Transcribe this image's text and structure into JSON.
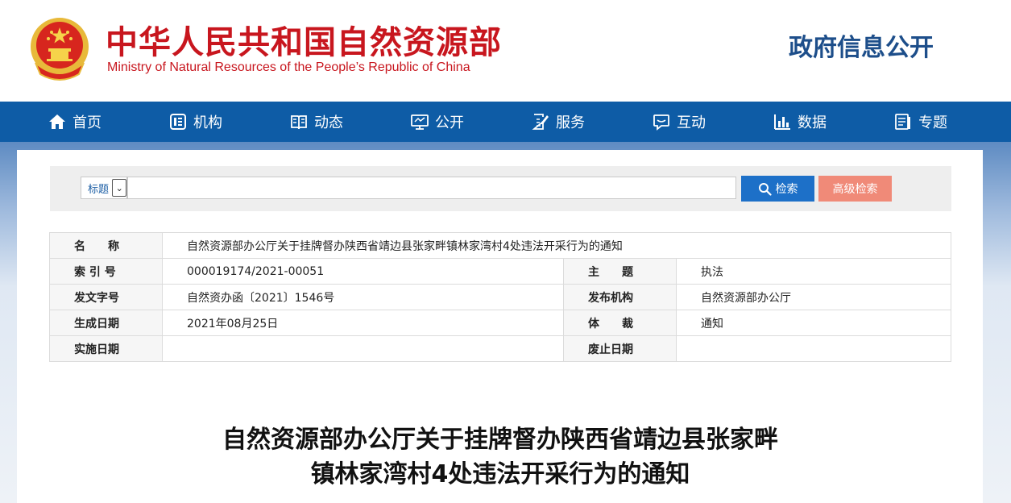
{
  "header": {
    "ministry_cn": "中华人民共和国自然资源部",
    "ministry_en": "Ministry of Natural Resources of the People’s Republic of China",
    "section_title": "政府信息公开",
    "emblem_icon": "national-emblem",
    "brand_red": "#c8161e",
    "brand_blue": "#1d4e8a"
  },
  "nav": {
    "bg_color": "#0e5ca6",
    "items": [
      {
        "label": "首页",
        "icon": "home-icon"
      },
      {
        "label": "机构",
        "icon": "org-icon"
      },
      {
        "label": "动态",
        "icon": "book-icon"
      },
      {
        "label": "公开",
        "icon": "monitor-icon"
      },
      {
        "label": "服务",
        "icon": "edit-doc-icon"
      },
      {
        "label": "互动",
        "icon": "chat-icon"
      },
      {
        "label": "数据",
        "icon": "bar-chart-icon"
      },
      {
        "label": "专题",
        "icon": "document-icon"
      }
    ]
  },
  "search": {
    "field_selected": "标题",
    "query": "",
    "search_label": "检索",
    "advanced_label": "高级检索"
  },
  "meta": {
    "name_label": "名　　称",
    "name_value": "自然资源部办公厅关于挂牌督办陕西省靖边县张家畔镇林家湾村4处违法开采行为的通知",
    "index_label": "索 引 号",
    "index_value": "000019174/2021-00051",
    "subject_label": "主　　题",
    "subject_value": "执法",
    "docno_label": "发文字号",
    "docno_value": "自然资办函〔2021〕1546号",
    "issuer_label": "发布机构",
    "issuer_value": "自然资源部办公厅",
    "date_label": "生成日期",
    "date_value": "2021年08月25日",
    "genre_label": "体　　裁",
    "genre_value": "通知",
    "effective_label": "实施日期",
    "effective_value": "",
    "expiry_label": "废止日期",
    "expiry_value": ""
  },
  "document": {
    "title_line1": "自然资源部办公厅关于挂牌督办陕西省靖边县张家畔",
    "title_line2": "镇林家湾村4处违法开采行为的通知"
  }
}
